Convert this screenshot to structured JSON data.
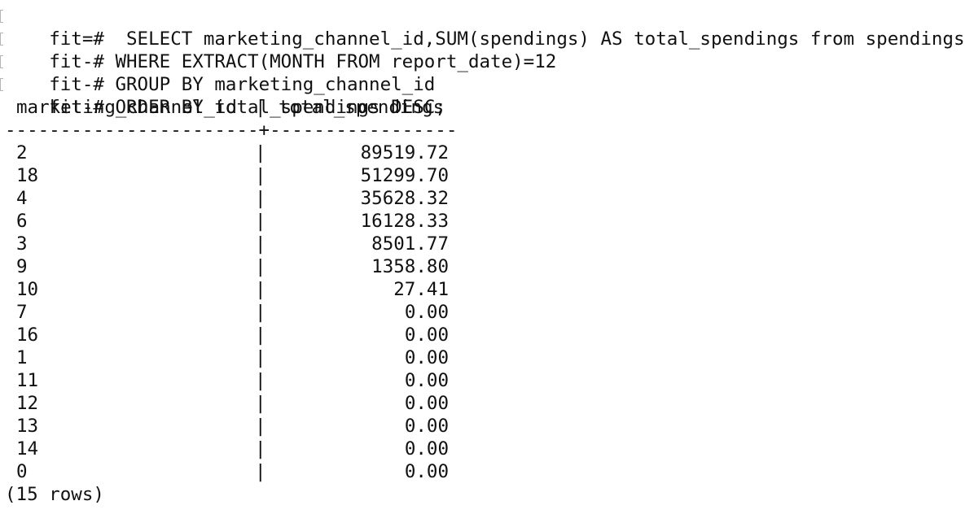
{
  "terminal": {
    "prompt_first": "fit=# ",
    "prompt_cont": "fit-# ",
    "query_lines": [
      " SELECT marketing_channel_id,SUM(spendings) AS total_spendings from spendings",
      "WHERE EXTRACT(MONTH FROM report_date)=12",
      "GROUP BY marketing_channel_id",
      "ORDER BY total_spendings DESC;"
    ],
    "table": {
      "columns": [
        "marketing_channel_id",
        "total_spendings"
      ],
      "separator": "|",
      "rule": "-----------------------+-----------------",
      "rows": [
        {
          "marketing_channel_id": "2",
          "total_spendings": "89519.72"
        },
        {
          "marketing_channel_id": "18",
          "total_spendings": "51299.70"
        },
        {
          "marketing_channel_id": "4",
          "total_spendings": "35628.32"
        },
        {
          "marketing_channel_id": "6",
          "total_spendings": "16128.33"
        },
        {
          "marketing_channel_id": "3",
          "total_spendings": "8501.77"
        },
        {
          "marketing_channel_id": "9",
          "total_spendings": "1358.80"
        },
        {
          "marketing_channel_id": "10",
          "total_spendings": "27.41"
        },
        {
          "marketing_channel_id": "7",
          "total_spendings": "0.00"
        },
        {
          "marketing_channel_id": "16",
          "total_spendings": "0.00"
        },
        {
          "marketing_channel_id": "1",
          "total_spendings": "0.00"
        },
        {
          "marketing_channel_id": "11",
          "total_spendings": "0.00"
        },
        {
          "marketing_channel_id": "12",
          "total_spendings": "0.00"
        },
        {
          "marketing_channel_id": "13",
          "total_spendings": "0.00"
        },
        {
          "marketing_channel_id": "14",
          "total_spendings": "0.00"
        },
        {
          "marketing_channel_id": "0",
          "total_spendings": "0.00"
        }
      ]
    },
    "footer": "(15 rows)"
  }
}
